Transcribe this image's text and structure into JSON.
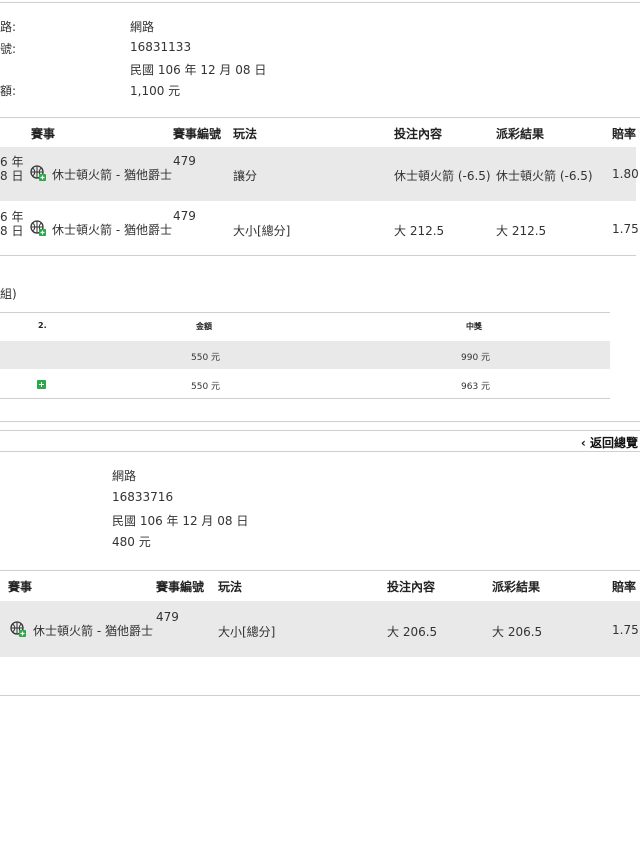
{
  "slip1": {
    "info_labels": [
      "路:",
      "號:",
      "額:"
    ],
    "info_values": [
      "網路",
      "16831133",
      "民國 106 年 12 月 08 日",
      "1,100 元"
    ],
    "headers": [
      "賽事",
      "賽事編號",
      "玩法",
      "投注內容",
      "派彩結果",
      "賠率"
    ],
    "rows": [
      {
        "date1": "6 年",
        "date2": "8 日",
        "match": "休士頓火箭 - 猶他爵士",
        "code": "479",
        "play": "讓分",
        "bet": "休士頓火箭 (-6.5)",
        "result": "休士頓火箭 (-6.5)",
        "odds": "1.80"
      },
      {
        "date1": "6 年",
        "date2": "8 日",
        "match": "休士頓火箭 - 猶他爵士",
        "code": "479",
        "play": "大小[總分]",
        "bet": "大 212.5",
        "result": "大 212.5",
        "odds": "1.75"
      }
    ],
    "combo_label": "組)",
    "combo_headers": [
      "2.",
      "金額",
      "中獎"
    ],
    "combo_rows": [
      {
        "amount": "550 元",
        "win": "990 元"
      },
      {
        "amount": "550 元",
        "win": "963 元"
      }
    ]
  },
  "back_link": "‹ 返回總覽",
  "slip2": {
    "info_values": [
      "網路",
      "16833716",
      "民國 106 年 12 月 08 日",
      "480 元"
    ],
    "headers": [
      "賽事",
      "賽事編號",
      "玩法",
      "投注內容",
      "派彩結果",
      "賠率"
    ],
    "rows": [
      {
        "match": "休士頓火箭 - 猶他爵士",
        "code": "479",
        "play": "大小[總分]",
        "bet": "大 206.5",
        "result": "大 206.5",
        "odds": "1.75"
      }
    ]
  }
}
